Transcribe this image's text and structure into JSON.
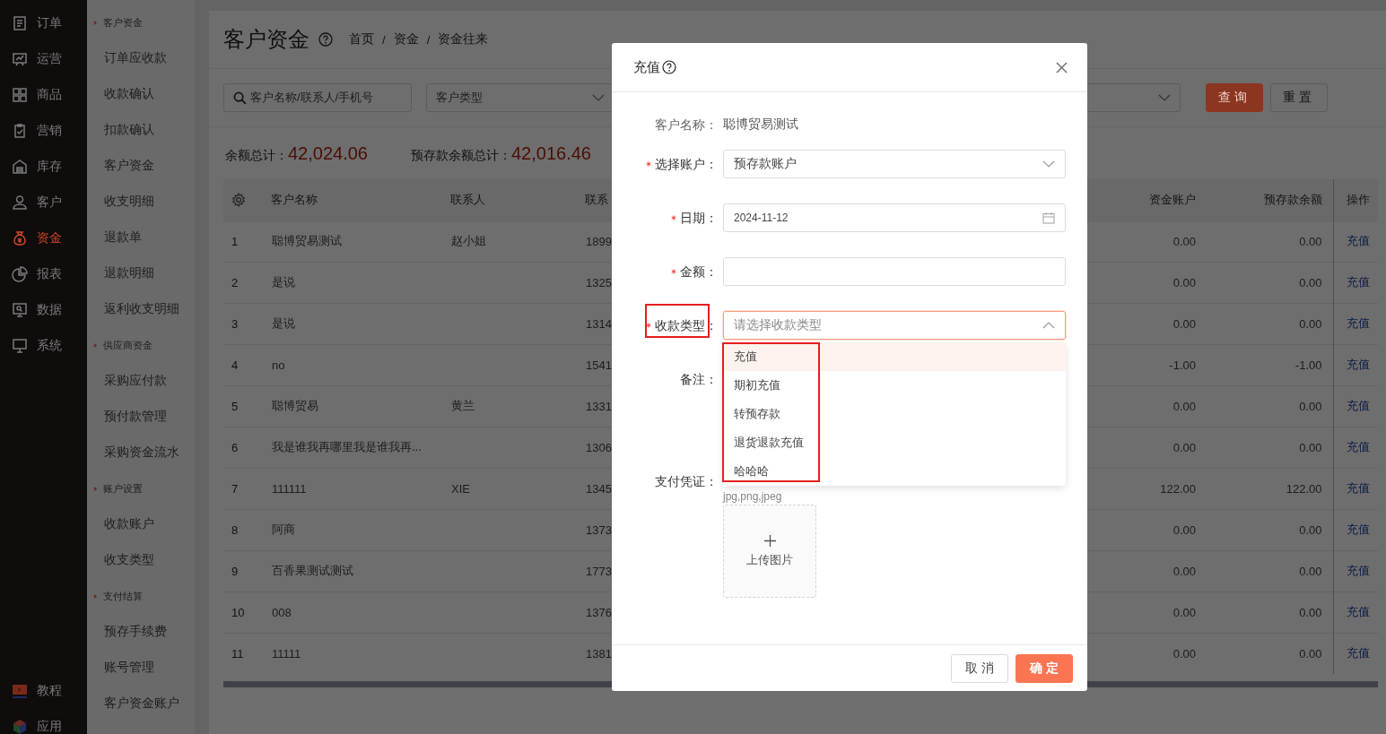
{
  "nav": {
    "items": [
      {
        "label": "订单",
        "selected": false
      },
      {
        "label": "运营",
        "selected": false
      },
      {
        "label": "商品",
        "selected": false
      },
      {
        "label": "营销",
        "selected": false
      },
      {
        "label": "库存",
        "selected": false
      },
      {
        "label": "客户",
        "selected": false
      },
      {
        "label": "资金",
        "selected": true
      },
      {
        "label": "报表",
        "selected": false
      },
      {
        "label": "数据",
        "selected": false
      },
      {
        "label": "系统",
        "selected": false
      }
    ],
    "bottom": [
      {
        "label": "教程"
      },
      {
        "label": "应用"
      }
    ]
  },
  "submenu": [
    {
      "kind": "group",
      "label": "客户资金"
    },
    {
      "kind": "item",
      "label": "订单应收款"
    },
    {
      "kind": "item",
      "label": "收款确认"
    },
    {
      "kind": "item",
      "label": "扣款确认"
    },
    {
      "kind": "item",
      "label": "客户资金"
    },
    {
      "kind": "item",
      "label": "收支明细"
    },
    {
      "kind": "item",
      "label": "退款单"
    },
    {
      "kind": "item",
      "label": "退款明细"
    },
    {
      "kind": "item",
      "label": "返利收支明细"
    },
    {
      "kind": "group",
      "label": "供应商资金"
    },
    {
      "kind": "item",
      "label": "采购应付款"
    },
    {
      "kind": "item",
      "label": "预付款管理"
    },
    {
      "kind": "item",
      "label": "采购资金流水"
    },
    {
      "kind": "group",
      "label": "账户设置"
    },
    {
      "kind": "item",
      "label": "收款账户"
    },
    {
      "kind": "item",
      "label": "收支类型"
    },
    {
      "kind": "group",
      "label": "支付结算"
    },
    {
      "kind": "item",
      "label": "预存手续费"
    },
    {
      "kind": "item",
      "label": "账号管理"
    },
    {
      "kind": "item",
      "label": "客户资金账户"
    }
  ],
  "page": {
    "title": "客户资金",
    "breadcrumb": [
      "首页",
      "资金",
      "资金往来"
    ],
    "breadcrumb_separator": "/"
  },
  "filters": {
    "search_placeholder": "客户名称/联系人/手机号",
    "type_placeholder": "客户类型",
    "query": "查询",
    "reset": "重置"
  },
  "totals": [
    {
      "label": "余额总计：",
      "value": "42,024.06"
    },
    {
      "label": "预存款余额总计：",
      "value": "42,016.46"
    }
  ],
  "table": {
    "columns": [
      "客户名称",
      "联系人",
      "联系",
      "资金账户",
      "预存款余额",
      "操作"
    ],
    "rows": [
      {
        "index": "1",
        "name": "聪博贸易测试",
        "contact": "赵小姐",
        "phone": "1899",
        "fund": "0.00",
        "prepaid": "0.00",
        "action": "充值"
      },
      {
        "index": "2",
        "name": "是说",
        "phone": "1325",
        "fund": "0.00",
        "prepaid": "0.00",
        "action": "充值"
      },
      {
        "index": "3",
        "name": "是说",
        "phone": "1314",
        "fund": "0.00",
        "prepaid": "0.00",
        "action": "充值"
      },
      {
        "index": "4",
        "name": "no",
        "phone": "1541",
        "fund": "-1.00",
        "prepaid": "-1.00",
        "action": "充值"
      },
      {
        "index": "5",
        "name": "聪博贸易",
        "contact": "黄兰",
        "phone": "1331",
        "fund": "0.00",
        "prepaid": "0.00",
        "action": "充值"
      },
      {
        "index": "6",
        "name": "我是谁我再哪里我是谁我再...",
        "phone": "1306",
        "fund": "0.00",
        "prepaid": "0.00",
        "action": "充值"
      },
      {
        "index": "7",
        "name": "111111",
        "contact": "XIE",
        "phone": "1345",
        "fund": "122.00",
        "prepaid": "122.00",
        "action": "充值"
      },
      {
        "index": "8",
        "name": "阿商",
        "phone": "1373",
        "fund": "0.00",
        "prepaid": "0.00",
        "action": "充值"
      },
      {
        "index": "9",
        "name": "百香果测试测试",
        "phone": "1773",
        "fund": "0.00",
        "prepaid": "0.00",
        "action": "充值"
      },
      {
        "index": "10",
        "name": "008",
        "phone": "1376",
        "fund": "0.00",
        "prepaid": "0.00",
        "action": "充值"
      },
      {
        "index": "11",
        "name": "11111",
        "phone": "1381",
        "fund": "0.00",
        "prepaid": "0.00",
        "action": "充值"
      }
    ]
  },
  "dialog": {
    "title": "充值",
    "fields": [
      {
        "kind": "text",
        "label": "客户名称：",
        "value": "聪博贸易测试",
        "required": false
      },
      {
        "kind": "select",
        "label": "选择账户：",
        "value": "预存款账户",
        "required": true,
        "expanded": false
      },
      {
        "kind": "date",
        "label": "日期：",
        "value": "2024-11-12",
        "required": true
      },
      {
        "kind": "input",
        "label": "金额：",
        "required": true
      },
      {
        "kind": "select",
        "label": "收款类型：",
        "placeholder": "请选择收款类型",
        "required": true,
        "expanded": true
      },
      {
        "kind": "textarea",
        "label": "备注：",
        "required": false
      },
      {
        "kind": "upload",
        "label": "支付凭证：",
        "hint": "jpg,png,jpeg",
        "button": "上传图片",
        "required": false
      }
    ],
    "options": [
      {
        "label": "充值",
        "selected": true
      },
      {
        "label": "期初充值",
        "selected": false
      },
      {
        "label": "转预存款",
        "selected": false
      },
      {
        "label": "退货退款充值",
        "selected": false
      },
      {
        "label": "哈哈哈",
        "selected": false
      }
    ],
    "cancel": "取消",
    "confirm": "确定"
  }
}
